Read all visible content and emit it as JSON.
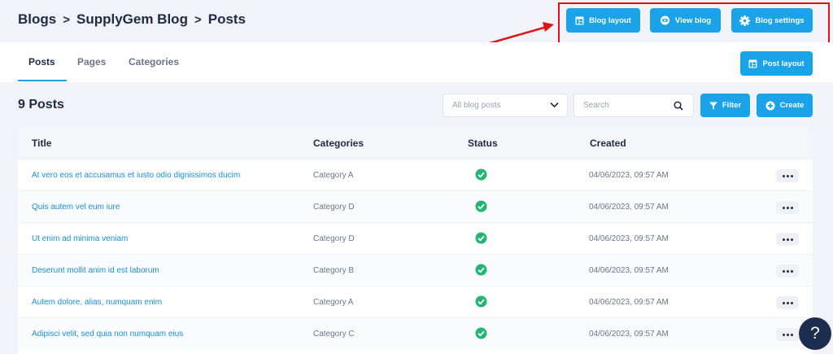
{
  "breadcrumb": {
    "blogs": "Blogs",
    "blog_name": "SupplyGem Blog",
    "posts": "Posts",
    "separator": ">"
  },
  "header_buttons": {
    "blog_layout": "Blog layout",
    "view_blog": "View blog",
    "blog_settings": "Blog settings"
  },
  "tabs": {
    "posts": "Posts",
    "pages": "Pages",
    "categories": "Categories"
  },
  "post_layout_button": "Post layout",
  "post_count": "9 Posts",
  "filter_select": {
    "value": "All blog posts"
  },
  "search": {
    "placeholder": "Search"
  },
  "filter_button": "Filter",
  "create_button": "Create",
  "columns": {
    "title": "Title",
    "categories": "Categories",
    "status": "Status",
    "created": "Created"
  },
  "rows": [
    {
      "title": "At vero eos et accusamus et iusto odio dignissimos ducim",
      "category": "Category A",
      "created": "04/06/2023, 09:57 AM"
    },
    {
      "title": "Quis autem vel eum iure",
      "category": "Category D",
      "created": "04/06/2023, 09:57 AM"
    },
    {
      "title": "Ut enim ad minima veniam",
      "category": "Category D",
      "created": "04/06/2023, 09:57 AM"
    },
    {
      "title": "Deserunt mollit anim id est laborum",
      "category": "Category B",
      "created": "04/06/2023, 09:57 AM"
    },
    {
      "title": "Autem dolore, alias, numquam enim",
      "category": "Category A",
      "created": "04/06/2023, 09:57 AM"
    },
    {
      "title": "Adipisci velit, sed quia non numquam eius",
      "category": "Category C",
      "created": "04/06/2023, 09:57 AM"
    }
  ],
  "help_button": "?",
  "colors": {
    "accent": "#1aa3e8",
    "annotation": "#e01414",
    "status_ok": "#22b573",
    "title_link": "#1a8fd6",
    "dark": "#1f2a44"
  },
  "icons": [
    "layout-icon",
    "eye-icon",
    "gear-icon",
    "filter-icon",
    "plus-circle-icon",
    "search-icon",
    "chevron-down-icon",
    "check-circle-icon",
    "more-icon",
    "help-icon"
  ]
}
